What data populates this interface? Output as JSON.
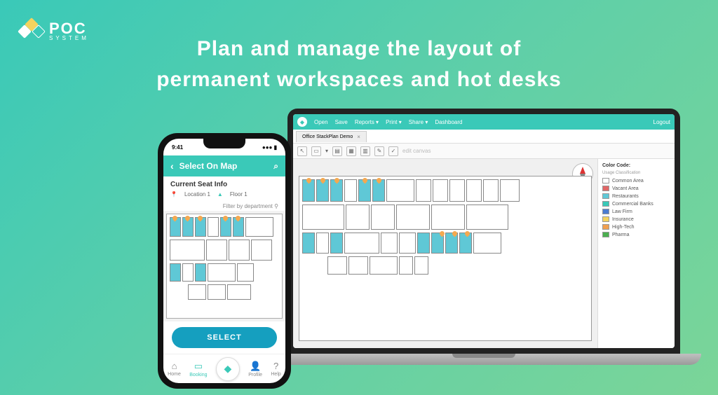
{
  "brand": {
    "name": "POC",
    "sub": "SYSTEM"
  },
  "headline_l1": "Plan and manage the layout of",
  "headline_l2": "permanent workspaces and hot desks",
  "laptop": {
    "menu": {
      "open": "Open",
      "save": "Save",
      "reports": "Reports ▾",
      "print": "Print ▾",
      "share": "Share ▾",
      "dashboard": "Dashboard",
      "logout": "Logout"
    },
    "tab": {
      "label": "Office StackPlan Demo"
    },
    "toolbar_hint": "edit canvas",
    "legend": {
      "title": "Color Code:",
      "subtitle": "Usage Classification",
      "items": [
        {
          "label": "Common Area",
          "color": "#ffffff"
        },
        {
          "label": "Vacant Area",
          "color": "#e06666"
        },
        {
          "label": "Restaurants",
          "color": "#5fc8d6"
        },
        {
          "label": "Commercial Banks",
          "color": "#3ac9b8"
        },
        {
          "label": "Law Firm",
          "color": "#4b7bd1"
        },
        {
          "label": "Insurance",
          "color": "#f4d35e"
        },
        {
          "label": "High-Tech",
          "color": "#f0a050"
        },
        {
          "label": "Pharma",
          "color": "#4caf50"
        }
      ]
    }
  },
  "phone": {
    "time": "9:41",
    "header": "Select On Map",
    "seat_info": "Current Seat Info",
    "location": "Location 1",
    "floor": "Floor 1",
    "filter": "Filter by department",
    "select_btn": "SELECT",
    "nav": {
      "home": "Home",
      "booking": "Booking",
      "profile": "Profile",
      "help": "Help"
    }
  }
}
